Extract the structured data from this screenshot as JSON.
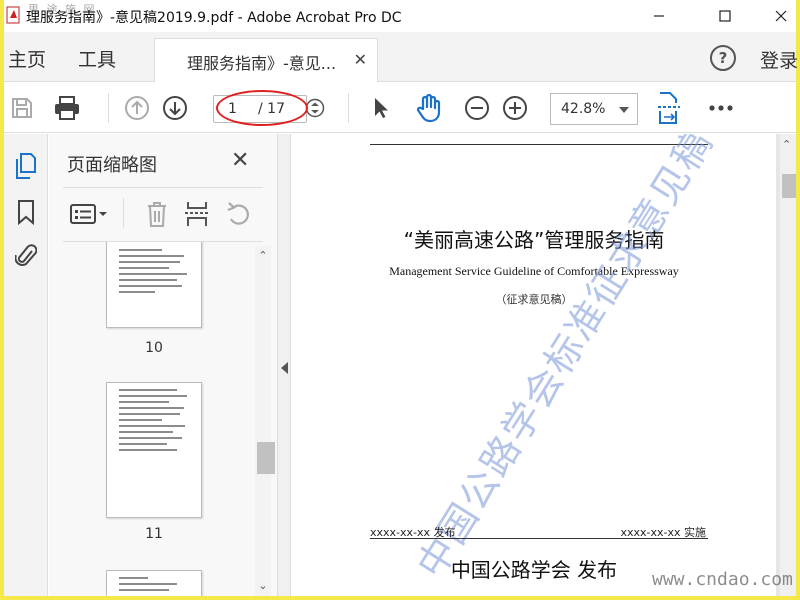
{
  "window": {
    "title": "理服务指南》-意见稿2019.9.pdf - Adobe Acrobat Pro DC",
    "corner_watermark": "思 途 施 网"
  },
  "tabs": {
    "home": "主页",
    "tools": "工具",
    "document_tab": "理服务指南》-意见...",
    "sign_in": "登录"
  },
  "toolbar": {
    "current_page": "1",
    "total_pages": "/ 17",
    "zoom": "42.8%"
  },
  "thumbnail_panel": {
    "title": "页面缩略图",
    "pages": [
      {
        "number": "10"
      },
      {
        "number": "11"
      }
    ]
  },
  "document": {
    "title": "“美丽高速公路”管理服务指南",
    "subtitle": "Management Service Guideline of Comfortable Expressway",
    "draft_note": "（征求意见稿）",
    "watermark": "中国公路学会标准征求意见稿",
    "issue_date": "xxxx-xx-xx 发布",
    "implement_date": "xxxx-xx-xx 实施",
    "publisher": "中国公路学会  发布"
  },
  "site_watermark": "www.cndao.com",
  "colors": {
    "accent_blue": "#1a73c9",
    "annotation_red": "#e02020",
    "frame_yellow": "#f5e94a"
  }
}
